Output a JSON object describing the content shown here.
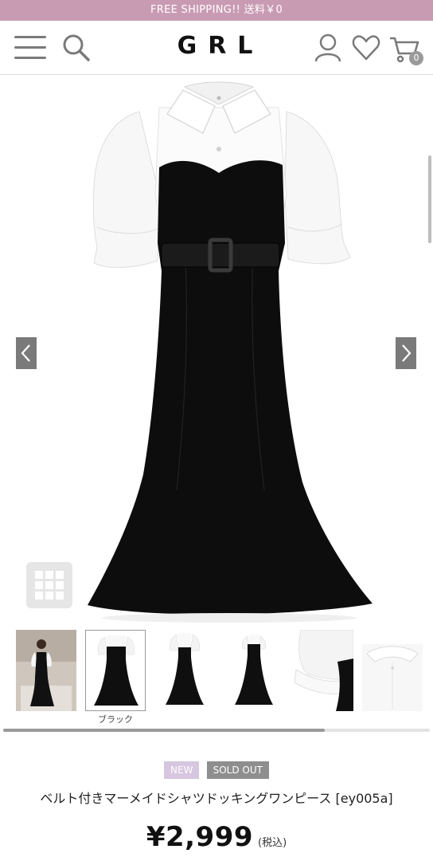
{
  "promo": {
    "text": "FREE SHIPPING!! 送料￥0"
  },
  "header": {
    "logo": "GRL",
    "cart_count": "0",
    "icons": [
      "menu-icon",
      "search-icon",
      "user-icon",
      "heart-icon",
      "cart-icon"
    ]
  },
  "gallery": {
    "main_image": "black mermaid dress with white puff-sleeve shirt collar and black belt",
    "prev_icon": "chevron-left-icon",
    "next_icon": "chevron-right-icon",
    "grid_icon": "grid-icon"
  },
  "thumbnails": {
    "items": [
      "model wearing dress",
      "dress front view",
      "dress front view",
      "dress front view",
      "sleeve detail",
      "collar back detail"
    ],
    "active_caption": "ブラック"
  },
  "product": {
    "badge_new": "NEW",
    "badge_sold": "SOLD OUT",
    "name": "ベルト付きマーメイドシャツドッキングワンピース [ey005a]",
    "price": "¥2,999",
    "tax_note": "(税込)"
  },
  "colors": {
    "promo_bg": "#c99bb3",
    "badge_new_bg": "#d7c6df",
    "badge_sold_bg": "#8e8e8e"
  }
}
